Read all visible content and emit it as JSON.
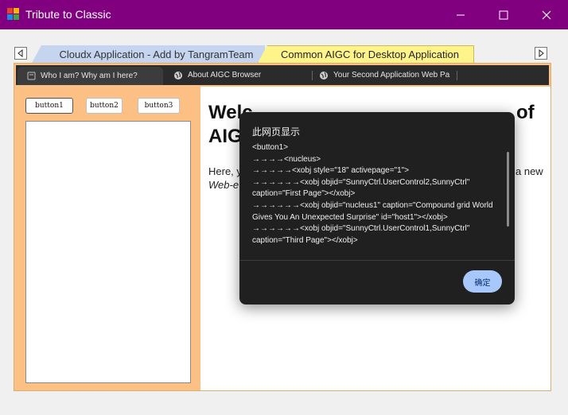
{
  "window": {
    "title": "Tribute to Classic",
    "icon": "app-grid-icon",
    "titlebar_color": "#800080"
  },
  "outer_tabs": [
    {
      "label": "Cloudx Application - Add by TangramTeam",
      "selected": false
    },
    {
      "label": "Common AIGC for Desktop Application",
      "selected": true
    }
  ],
  "browser_tabs": [
    {
      "label": "Who I am? Why am I here?",
      "icon": "page-icon",
      "active": true
    },
    {
      "label": "About AIGC Browser",
      "icon": "globe-icon",
      "active": false
    },
    {
      "label": "Your Second Application Web Pa",
      "icon": "globe-icon",
      "active": false
    }
  ],
  "left_panel": {
    "buttons": [
      "button1",
      "button2",
      "button3"
    ],
    "background": "#fcbf84"
  },
  "web_page": {
    "heading_start": "Welc",
    "heading_end": "of",
    "heading_line2": "AIG",
    "para_line1_start": "Here, y",
    "para_line1_end": "a new",
    "para_line2_start": "Web-e"
  },
  "dialog": {
    "title": "此网页显示",
    "lines": [
      "<button1>",
      "→→→→<nucleus>",
      "→→→→→<xobj style=\"18\" activepage=\"1\">",
      "→→→→→→<xobj objid=\"SunnyCtrl.UserControl2,SunnyCtrl\" caption=\"First Page\"></xobj>",
      "→→→→→→<xobj objid=\"nucleus1\" caption=\"Compound grid World Gives You An Unexpected Surprise\" id=\"host1\"></xobj>",
      "→→→→→→<xobj objid=\"SunnyCtrl.UserControl1,SunnyCtrl\" caption=\"Third Page\"></xobj>"
    ],
    "ok_label": "确定",
    "accent": "#a8c7fa"
  }
}
